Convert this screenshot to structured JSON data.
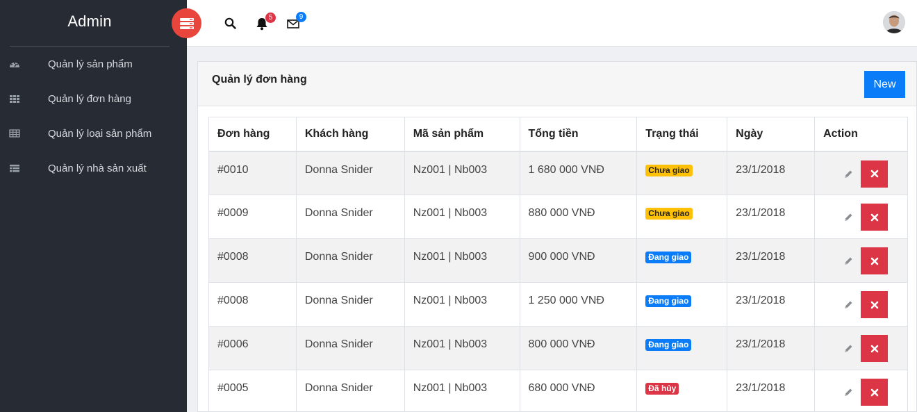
{
  "sidebar": {
    "brand": "Admin",
    "items": [
      {
        "label": "Quản lý sản phẩm",
        "icon": "dashboard-icon"
      },
      {
        "label": "Quản lý đơn hàng",
        "icon": "grid-icon"
      },
      {
        "label": "Quản lý loại sản phẩm",
        "icon": "table-icon"
      },
      {
        "label": "Quản lý nhà sản xuất",
        "icon": "list-icon"
      }
    ]
  },
  "topbar": {
    "notifications_count": "5",
    "messages_count": "9"
  },
  "card": {
    "title": "Quản lý đơn hàng",
    "new_label": "New"
  },
  "table": {
    "headers": [
      "Đơn hàng",
      "Khách hàng",
      "Mã sản phẩm",
      "Tổng tiền",
      "Trạng thái",
      "Ngày",
      "Action"
    ],
    "rows": [
      {
        "order": "#0010",
        "customer": "Donna Snider",
        "products": "Nz001 | Nb003",
        "total": "1 680 000 VNĐ",
        "status": "Chưa giao",
        "status_type": "warning",
        "date": "23/1/2018"
      },
      {
        "order": "#0009",
        "customer": "Donna Snider",
        "products": "Nz001 | Nb003",
        "total": "880 000 VNĐ",
        "status": "Chưa giao",
        "status_type": "warning",
        "date": "23/1/2018"
      },
      {
        "order": "#0008",
        "customer": "Donna Snider",
        "products": "Nz001 | Nb003",
        "total": "900 000 VNĐ",
        "status": "Đang giao",
        "status_type": "primary",
        "date": "23/1/2018"
      },
      {
        "order": "#0008",
        "customer": "Donna Snider",
        "products": "Nz001 | Nb003",
        "total": "1 250 000 VNĐ",
        "status": "Đang giao",
        "status_type": "primary",
        "date": "23/1/2018"
      },
      {
        "order": "#0006",
        "customer": "Donna Snider",
        "products": "Nz001 | Nb003",
        "total": "800 000 VNĐ",
        "status": "Đang giao",
        "status_type": "primary",
        "date": "23/1/2018"
      },
      {
        "order": "#0005",
        "customer": "Donna Snider",
        "products": "Nz001 | Nb003",
        "total": "680 000 VNĐ",
        "status": "Đã hủy",
        "status_type": "danger",
        "date": "23/1/2018"
      }
    ]
  },
  "colors": {
    "sidebar_bg": "#272b34",
    "accent_red": "#e8453c",
    "primary": "#0b7cf8",
    "danger": "#dc3545",
    "warning": "#ffc107"
  }
}
